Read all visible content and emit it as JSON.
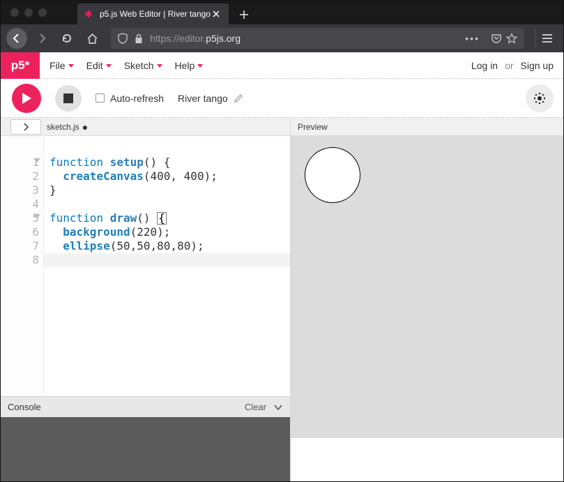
{
  "browser": {
    "tab_title": "p5.js Web Editor | River tango",
    "url_prefix": "https://editor.",
    "url_host": "p5js.org",
    "url_suffix": ""
  },
  "menu": {
    "logo": "p5*",
    "items": [
      "File",
      "Edit",
      "Sketch",
      "Help"
    ]
  },
  "auth": {
    "login": "Log in",
    "or": "or",
    "signup": "Sign up"
  },
  "toolbar": {
    "auto_refresh": "Auto-refresh",
    "sketch_name": "River tango"
  },
  "editor": {
    "filename": "sketch.js",
    "lines": [
      {
        "n": 1,
        "fold": true,
        "segs": [
          [
            "kw",
            "function"
          ],
          [
            "plain",
            " "
          ],
          [
            "fn",
            "setup"
          ],
          [
            "plain",
            "() {"
          ]
        ]
      },
      {
        "n": 2,
        "fold": false,
        "segs": [
          [
            "plain",
            "  "
          ],
          [
            "call",
            "createCanvas"
          ],
          [
            "plain",
            "("
          ],
          [
            "num",
            "400"
          ],
          [
            "plain",
            ", "
          ],
          [
            "num",
            "400"
          ],
          [
            "plain",
            ");"
          ]
        ]
      },
      {
        "n": 3,
        "fold": false,
        "segs": [
          [
            "plain",
            "}"
          ]
        ]
      },
      {
        "n": 4,
        "fold": false,
        "segs": [
          [
            "plain",
            ""
          ]
        ]
      },
      {
        "n": 5,
        "fold": true,
        "segs": [
          [
            "kw",
            "function"
          ],
          [
            "plain",
            " "
          ],
          [
            "fn",
            "draw"
          ],
          [
            "plain",
            "() "
          ],
          [
            "boxbr",
            "{"
          ]
        ]
      },
      {
        "n": 6,
        "fold": false,
        "segs": [
          [
            "plain",
            "  "
          ],
          [
            "call",
            "background"
          ],
          [
            "plain",
            "("
          ],
          [
            "num",
            "220"
          ],
          [
            "plain",
            ");"
          ]
        ]
      },
      {
        "n": 7,
        "fold": false,
        "segs": [
          [
            "plain",
            "  "
          ],
          [
            "call",
            "ellipse"
          ],
          [
            "plain",
            "("
          ],
          [
            "num",
            "50"
          ],
          [
            "plain",
            ","
          ],
          [
            "num",
            "50"
          ],
          [
            "plain",
            ","
          ],
          [
            "num",
            "80"
          ],
          [
            "plain",
            ","
          ],
          [
            "num",
            "80"
          ],
          [
            "plain",
            ");"
          ]
        ]
      },
      {
        "n": 8,
        "fold": false,
        "segs": [
          [
            "boxbr",
            "}"
          ]
        ]
      }
    ]
  },
  "console": {
    "title": "Console",
    "clear": "Clear"
  },
  "preview": {
    "title": "Preview"
  }
}
